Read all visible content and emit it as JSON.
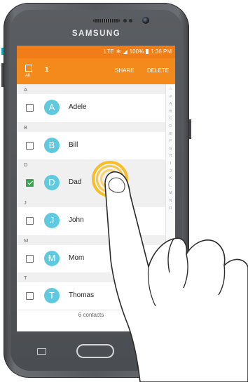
{
  "device": {
    "brand": "SAMSUNG"
  },
  "status_bar": {
    "network": "LTE",
    "battery": "100%",
    "time": "1:36 PM"
  },
  "action_bar": {
    "select_all_label": "All",
    "selected_count": "1",
    "share_label": "SHARE",
    "delete_label": "DELETE"
  },
  "contacts": {
    "sections": [
      {
        "letter": "A",
        "contacts": [
          {
            "initial": "A",
            "name": "Adele",
            "checked": false
          }
        ]
      },
      {
        "letter": "B",
        "contacts": [
          {
            "initial": "B",
            "name": "Bill",
            "checked": false
          }
        ]
      },
      {
        "letter": "D",
        "contacts": [
          {
            "initial": "D",
            "name": "Dad",
            "checked": true
          }
        ]
      },
      {
        "letter": "J",
        "contacts": [
          {
            "initial": "J",
            "name": "John",
            "checked": false
          }
        ]
      },
      {
        "letter": "M",
        "contacts": [
          {
            "initial": "M",
            "name": "Mom",
            "checked": false
          }
        ]
      },
      {
        "letter": "T",
        "contacts": [
          {
            "initial": "T",
            "name": "Thomas",
            "checked": false
          }
        ]
      }
    ],
    "footer": "6 contacts"
  },
  "index_letters": [
    "☆",
    "#",
    "A",
    "B",
    "C",
    "D",
    "E",
    "F",
    "G",
    "H",
    "I",
    "J",
    "K",
    "L",
    "M",
    "N",
    "O"
  ],
  "colors": {
    "accent": "#f48a1c",
    "avatar": "#5ec9df",
    "check": "#3aa64e",
    "tap": "#f7be27"
  },
  "icons": {
    "select_all": "checkbox-icon",
    "signal": "signal-icon",
    "battery": "battery-icon",
    "recent_apps": "recent-apps-icon"
  }
}
